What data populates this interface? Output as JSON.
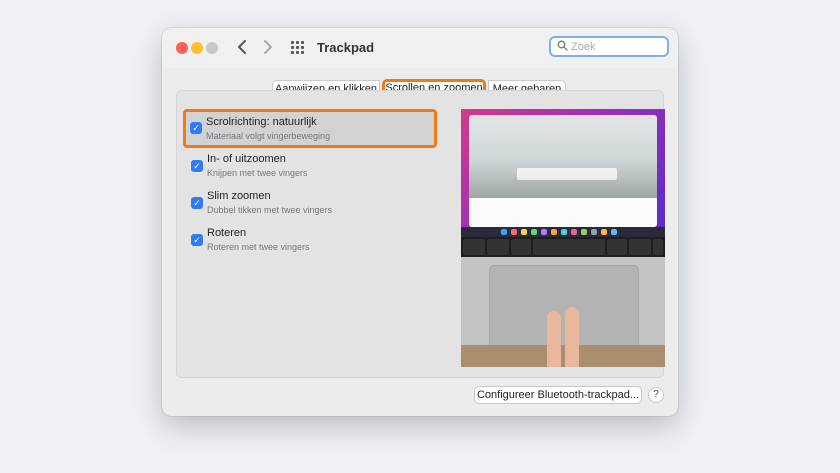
{
  "window": {
    "title": "Trackpad"
  },
  "toolbar": {
    "back_icon": "chevron-left-icon",
    "forward_icon": "chevron-right-icon",
    "grid_icon": "grid-icon",
    "search_placeholder": "Zoek",
    "search_value": ""
  },
  "tabs": [
    {
      "label": "Aanwijzen en klikken",
      "selected": false
    },
    {
      "label": "Scrollen en zoomen",
      "selected": true
    },
    {
      "label": "Meer gebaren",
      "selected": false
    }
  ],
  "options": [
    {
      "title": "Scrolrichting: natuurlijk",
      "subtitle": "Materiaal volgt vingerbeweging",
      "checked": true,
      "highlighted": true
    },
    {
      "title": "In- of uitzoomen",
      "subtitle": "Knijpen met twee vingers",
      "checked": true,
      "highlighted": false
    },
    {
      "title": "Slim zoomen",
      "subtitle": "Dubbel tikken met twee vingers",
      "checked": true,
      "highlighted": false
    },
    {
      "title": "Roteren",
      "subtitle": "Roteren met twee vingers",
      "checked": true,
      "highlighted": false
    }
  ],
  "footer": {
    "bluetooth_button": "Configureer Bluetooth-trackpad...",
    "help_button": "?"
  },
  "colors": {
    "accent_highlight": "#f07a1a",
    "checkbox_blue": "#2f7cf6",
    "close": "#ff5f57",
    "minimize": "#febc2e"
  }
}
